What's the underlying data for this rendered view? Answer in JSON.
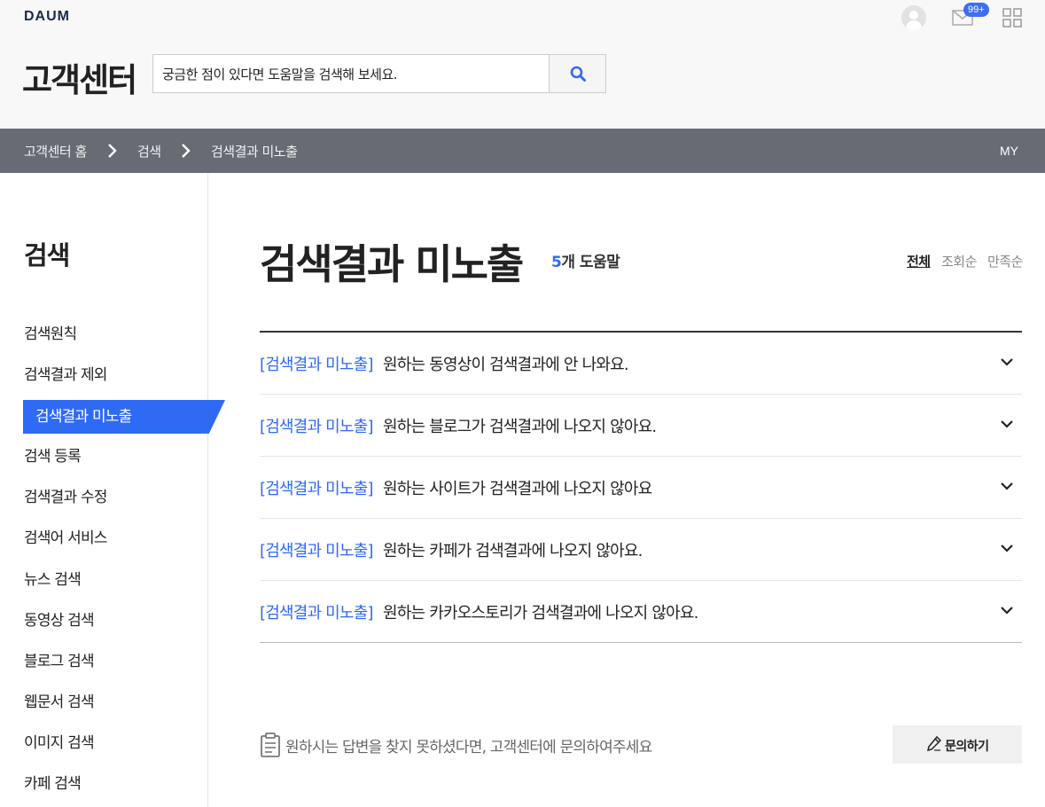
{
  "header": {
    "logo": "DAUM",
    "mail_badge": "99+",
    "title": "고객센터",
    "search_value": "궁금한 점이 있다면 도움말을 검색해 보세요."
  },
  "breadcrumb": {
    "items": [
      "고객센터 홈",
      "검색",
      "검색결과 미노출"
    ],
    "my": "MY"
  },
  "sidebar": {
    "title": "검색",
    "items": [
      {
        "label": "검색원칙"
      },
      {
        "label": "검색결과 제외"
      },
      {
        "label": "검색결과 미노출",
        "active": true
      },
      {
        "label": "검색 등록"
      },
      {
        "label": "검색결과 수정"
      },
      {
        "label": "검색어 서비스"
      },
      {
        "label": "뉴스 검색"
      },
      {
        "label": "동영상 검색"
      },
      {
        "label": "블로그 검색"
      },
      {
        "label": "웹문서 검색"
      },
      {
        "label": "이미지 검색"
      },
      {
        "label": "카페 검색"
      }
    ]
  },
  "main": {
    "title": "검색결과 미노출",
    "count_num": "5",
    "count_suffix": "개 도움말",
    "sort": [
      "전체",
      "조회순",
      "만족순"
    ],
    "faq": [
      {
        "tag": "[검색결과 미노출]",
        "question": "원하는 동영상이 검색결과에 안 나와요."
      },
      {
        "tag": "[검색결과 미노출]",
        "question": "원하는 블로그가 검색결과에 나오지 않아요."
      },
      {
        "tag": "[검색결과 미노출]",
        "question": "원하는 사이트가 검색결과에 나오지 않아요"
      },
      {
        "tag": "[검색결과 미노출]",
        "question": "원하는 카페가 검색결과에 나오지 않아요."
      },
      {
        "tag": "[검색결과 미노출]",
        "question": "원하는 카카오스토리가 검색결과에 나오지 않아요."
      }
    ],
    "footer_text": "원하시는 답변을 찾지 못하셨다면, 고객센터에 문의하여주세요",
    "ask_label": "문의하기"
  },
  "colors": {
    "accent": "#2f6af5",
    "breadcrumb_bg": "#666b74",
    "header_bg": "#f8f8f8"
  },
  "icons": [
    "avatar-icon",
    "mail-icon",
    "apps-grid-icon",
    "search-icon",
    "chevron-right-icon",
    "chevron-down-icon",
    "clipboard-icon",
    "pencil-icon"
  ]
}
